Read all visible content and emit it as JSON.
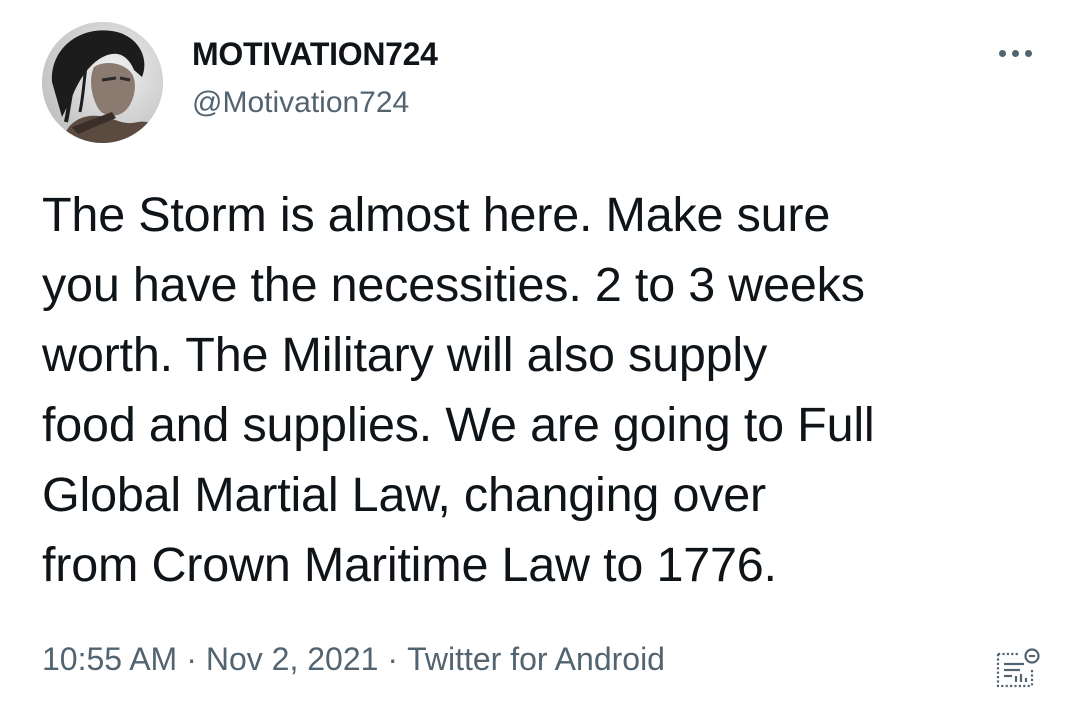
{
  "author": {
    "display_name": "MOTIVATION724",
    "handle": "@Motivation724",
    "avatar_icon": "profile-avatar-portrait"
  },
  "more_icon": "more-horizontal-icon",
  "tweet": {
    "lines": [
      "The Storm is almost here. Make sure",
      "you have the necessities. 2 to 3 weeks",
      "worth. The Military will also supply",
      "food and supplies. We are going to Full",
      "Global Martial Law, changing over",
      "from Crown Maritime Law to 1776."
    ]
  },
  "meta": {
    "time": "10:55 AM",
    "date": "Nov 2, 2021",
    "source": "Twitter for Android",
    "separator": "·"
  },
  "analytics_icon": "tweet-analytics-icon",
  "colors": {
    "text_primary": "#0f1419",
    "text_secondary": "#536471",
    "background": "#ffffff"
  }
}
